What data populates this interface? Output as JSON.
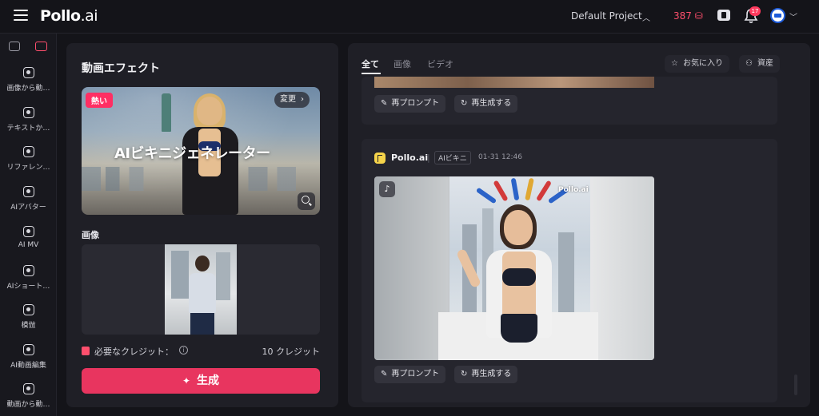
{
  "header": {
    "logo": "Pollo",
    "logo_suffix": ".ai",
    "project": "Default Project",
    "credits": "387",
    "notifications": "17"
  },
  "sidebar": {
    "items": [
      {
        "label": "画像から動…",
        "icon": "image-to-video-icon"
      },
      {
        "label": "テキストか…",
        "icon": "text-to-video-icon"
      },
      {
        "label": "リファレン…",
        "icon": "reference-icon"
      },
      {
        "label": "AIアバター",
        "icon": "avatar-icon"
      },
      {
        "label": "AI MV",
        "icon": "mv-icon"
      },
      {
        "label": "AIショート…",
        "icon": "short-video-icon"
      },
      {
        "label": "模倣",
        "icon": "imitate-icon"
      },
      {
        "label": "AI動画編集",
        "icon": "video-edit-icon"
      },
      {
        "label": "動画から動…",
        "icon": "video-to-video-icon"
      }
    ]
  },
  "left_panel": {
    "title": "動画エフェクト",
    "effect": {
      "badge": "熱い",
      "change": "変更",
      "name": "AIビキニジェネレーター"
    },
    "image_label": "画像",
    "credit_label": "必要なクレジット：",
    "credit_amount": "10 クレジット",
    "generate": "生成"
  },
  "right_panel": {
    "tabs": [
      "全て",
      "画像",
      "ビデオ"
    ],
    "favorites": "お気に入り",
    "assets": "資産",
    "reprompt": "再プロンプト",
    "regenerate": "再生成する",
    "post": {
      "author": "Pollo.ai",
      "tag": "AIビキニ",
      "time": "01-31 12:46",
      "watermark": "Pollo.ai"
    }
  },
  "colors": {
    "accent": "#e8355f",
    "credits": "#ff4f6d",
    "panel": "#1f1f26",
    "background": "#141419"
  }
}
